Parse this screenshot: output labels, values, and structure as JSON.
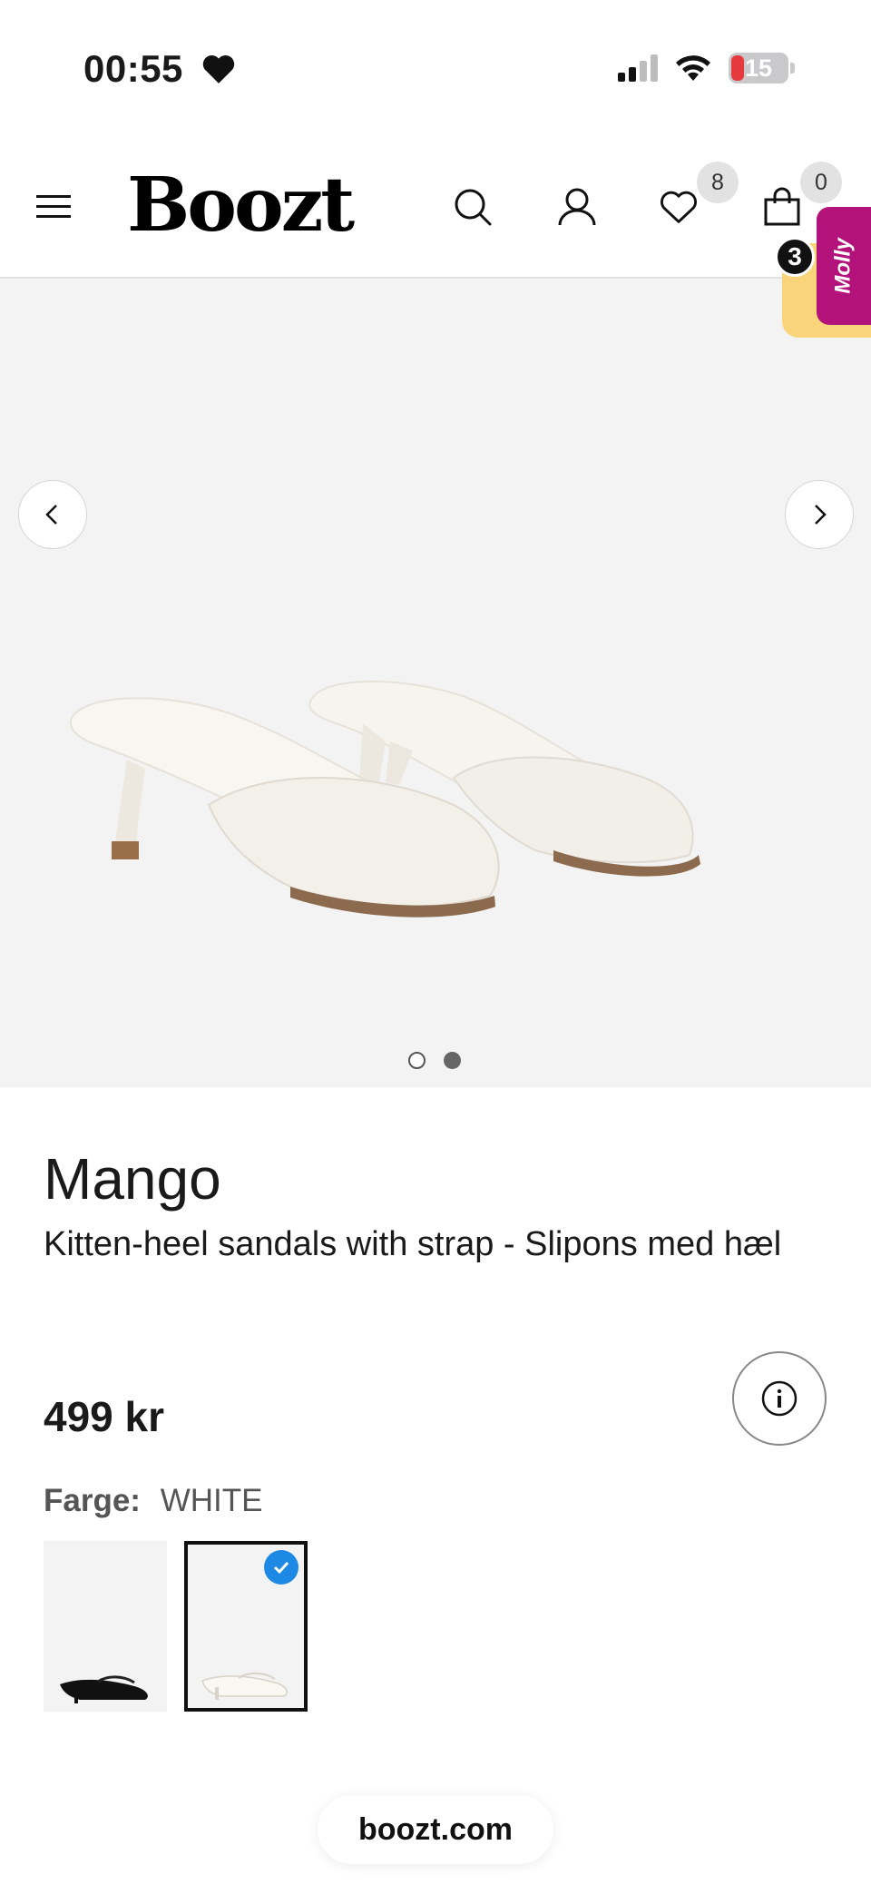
{
  "status_bar": {
    "time": "00:55",
    "battery_level": "15",
    "icons": [
      "heart-icon",
      "cellular-signal-icon",
      "wifi-icon",
      "battery-icon"
    ]
  },
  "header": {
    "logo": "Boozt",
    "wishlist_count": "8",
    "cart_count": "0",
    "icons": [
      "hamburger-menu-icon",
      "search-icon",
      "user-icon",
      "heart-icon",
      "shopping-bag-icon"
    ]
  },
  "molly": {
    "label": "Molly",
    "count": "3"
  },
  "gallery": {
    "image_count": 2,
    "active_index": 1,
    "icons": [
      "chevron-left-icon",
      "chevron-right-icon"
    ]
  },
  "product": {
    "brand": "Mango",
    "title": "Kitten-heel sandals with strap - Slipons med hæl",
    "price": "499 kr",
    "color_label": "Farge:",
    "color_value": "WHITE",
    "swatches": [
      {
        "color": "black",
        "selected": false
      },
      {
        "color": "white",
        "selected": true
      }
    ]
  },
  "footer": {
    "url": "boozt.com"
  },
  "colors": {
    "accent_blue": "#1e88e5",
    "molly_magenta": "#b3127a",
    "molly_yellow": "#f9d47a",
    "battery_red": "#e5393d"
  }
}
